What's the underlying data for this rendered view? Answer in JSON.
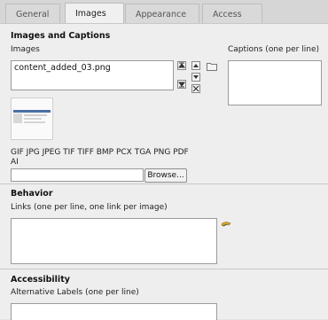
{
  "tabs": [
    "General",
    "Images",
    "Appearance",
    "Access"
  ],
  "images_section": {
    "title": "Images and Captions",
    "images_label": "Images",
    "captions_label": "Captions (one per line)",
    "files": [
      "content_added_03.png"
    ],
    "controls": [
      "move-up",
      "move-down",
      "move-bottom",
      "remove"
    ],
    "allowed_types_line1": "GIF JPG JPEG TIF TIFF BMP PCX TGA PNG PDF",
    "allowed_types_line2": "AI",
    "upload_value": "",
    "browse_label": "Browse..."
  },
  "behavior_section": {
    "title": "Behavior",
    "links_label": "Links (one per line, one link per image)",
    "links_value": ""
  },
  "accessibility_section": {
    "title": "Accessibility",
    "alt_label": "Alternative Labels (one per line)",
    "alt_value": ""
  },
  "colors": {
    "background": "#e3e3e3",
    "panel": "#eeeeee",
    "active_tab": "#f0f0f0"
  }
}
